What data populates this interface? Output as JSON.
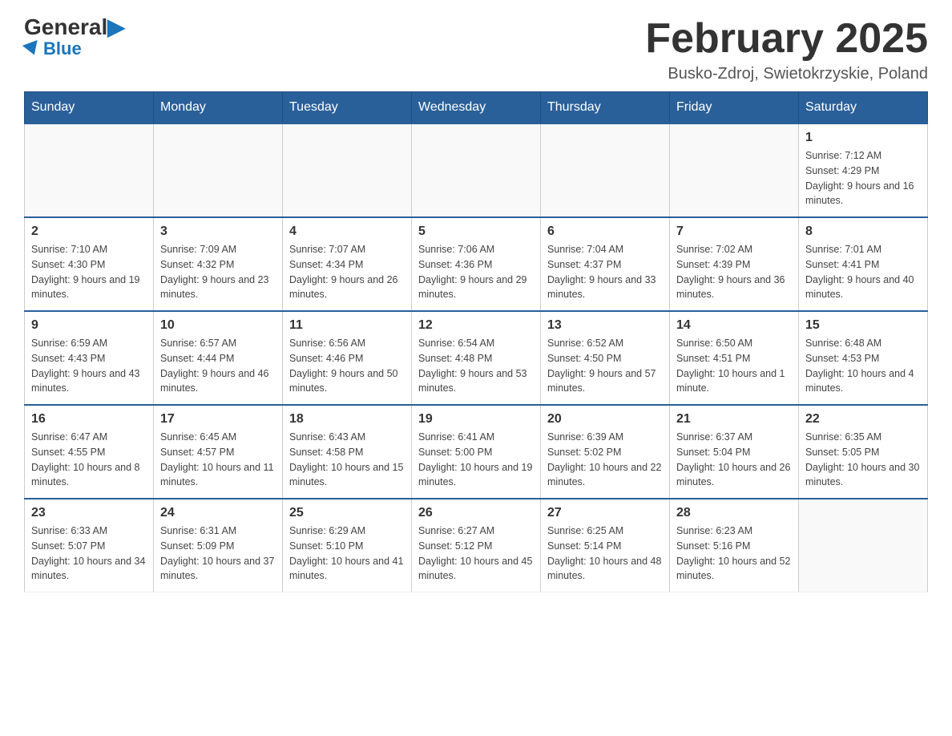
{
  "header": {
    "logo_general": "General",
    "logo_blue": "Blue",
    "month_title": "February 2025",
    "location": "Busko-Zdroj, Swietokrzyskie, Poland"
  },
  "weekdays": [
    "Sunday",
    "Monday",
    "Tuesday",
    "Wednesday",
    "Thursday",
    "Friday",
    "Saturday"
  ],
  "weeks": [
    [
      {
        "day": "",
        "info": ""
      },
      {
        "day": "",
        "info": ""
      },
      {
        "day": "",
        "info": ""
      },
      {
        "day": "",
        "info": ""
      },
      {
        "day": "",
        "info": ""
      },
      {
        "day": "",
        "info": ""
      },
      {
        "day": "1",
        "info": "Sunrise: 7:12 AM\nSunset: 4:29 PM\nDaylight: 9 hours and 16 minutes."
      }
    ],
    [
      {
        "day": "2",
        "info": "Sunrise: 7:10 AM\nSunset: 4:30 PM\nDaylight: 9 hours and 19 minutes."
      },
      {
        "day": "3",
        "info": "Sunrise: 7:09 AM\nSunset: 4:32 PM\nDaylight: 9 hours and 23 minutes."
      },
      {
        "day": "4",
        "info": "Sunrise: 7:07 AM\nSunset: 4:34 PM\nDaylight: 9 hours and 26 minutes."
      },
      {
        "day": "5",
        "info": "Sunrise: 7:06 AM\nSunset: 4:36 PM\nDaylight: 9 hours and 29 minutes."
      },
      {
        "day": "6",
        "info": "Sunrise: 7:04 AM\nSunset: 4:37 PM\nDaylight: 9 hours and 33 minutes."
      },
      {
        "day": "7",
        "info": "Sunrise: 7:02 AM\nSunset: 4:39 PM\nDaylight: 9 hours and 36 minutes."
      },
      {
        "day": "8",
        "info": "Sunrise: 7:01 AM\nSunset: 4:41 PM\nDaylight: 9 hours and 40 minutes."
      }
    ],
    [
      {
        "day": "9",
        "info": "Sunrise: 6:59 AM\nSunset: 4:43 PM\nDaylight: 9 hours and 43 minutes."
      },
      {
        "day": "10",
        "info": "Sunrise: 6:57 AM\nSunset: 4:44 PM\nDaylight: 9 hours and 46 minutes."
      },
      {
        "day": "11",
        "info": "Sunrise: 6:56 AM\nSunset: 4:46 PM\nDaylight: 9 hours and 50 minutes."
      },
      {
        "day": "12",
        "info": "Sunrise: 6:54 AM\nSunset: 4:48 PM\nDaylight: 9 hours and 53 minutes."
      },
      {
        "day": "13",
        "info": "Sunrise: 6:52 AM\nSunset: 4:50 PM\nDaylight: 9 hours and 57 minutes."
      },
      {
        "day": "14",
        "info": "Sunrise: 6:50 AM\nSunset: 4:51 PM\nDaylight: 10 hours and 1 minute."
      },
      {
        "day": "15",
        "info": "Sunrise: 6:48 AM\nSunset: 4:53 PM\nDaylight: 10 hours and 4 minutes."
      }
    ],
    [
      {
        "day": "16",
        "info": "Sunrise: 6:47 AM\nSunset: 4:55 PM\nDaylight: 10 hours and 8 minutes."
      },
      {
        "day": "17",
        "info": "Sunrise: 6:45 AM\nSunset: 4:57 PM\nDaylight: 10 hours and 11 minutes."
      },
      {
        "day": "18",
        "info": "Sunrise: 6:43 AM\nSunset: 4:58 PM\nDaylight: 10 hours and 15 minutes."
      },
      {
        "day": "19",
        "info": "Sunrise: 6:41 AM\nSunset: 5:00 PM\nDaylight: 10 hours and 19 minutes."
      },
      {
        "day": "20",
        "info": "Sunrise: 6:39 AM\nSunset: 5:02 PM\nDaylight: 10 hours and 22 minutes."
      },
      {
        "day": "21",
        "info": "Sunrise: 6:37 AM\nSunset: 5:04 PM\nDaylight: 10 hours and 26 minutes."
      },
      {
        "day": "22",
        "info": "Sunrise: 6:35 AM\nSunset: 5:05 PM\nDaylight: 10 hours and 30 minutes."
      }
    ],
    [
      {
        "day": "23",
        "info": "Sunrise: 6:33 AM\nSunset: 5:07 PM\nDaylight: 10 hours and 34 minutes."
      },
      {
        "day": "24",
        "info": "Sunrise: 6:31 AM\nSunset: 5:09 PM\nDaylight: 10 hours and 37 minutes."
      },
      {
        "day": "25",
        "info": "Sunrise: 6:29 AM\nSunset: 5:10 PM\nDaylight: 10 hours and 41 minutes."
      },
      {
        "day": "26",
        "info": "Sunrise: 6:27 AM\nSunset: 5:12 PM\nDaylight: 10 hours and 45 minutes."
      },
      {
        "day": "27",
        "info": "Sunrise: 6:25 AM\nSunset: 5:14 PM\nDaylight: 10 hours and 48 minutes."
      },
      {
        "day": "28",
        "info": "Sunrise: 6:23 AM\nSunset: 5:16 PM\nDaylight: 10 hours and 52 minutes."
      },
      {
        "day": "",
        "info": ""
      }
    ]
  ]
}
